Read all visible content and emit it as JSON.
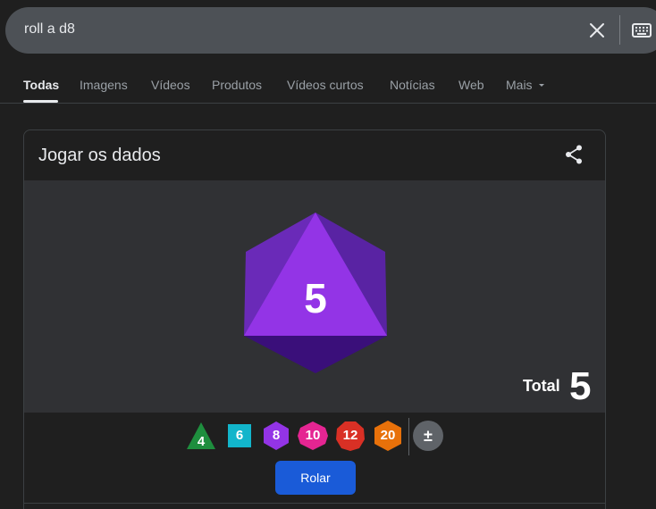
{
  "search": {
    "query": "roll a d8"
  },
  "tabs": [
    {
      "label": "Todas",
      "active": true
    },
    {
      "label": "Imagens"
    },
    {
      "label": "Vídeos"
    },
    {
      "label": "Produtos"
    },
    {
      "label": "Vídeos curtos"
    },
    {
      "label": "Notícias"
    },
    {
      "label": "Web"
    },
    {
      "label": "Mais"
    }
  ],
  "icons": {
    "clear": "close-icon",
    "keyboard": "keyboard-icon",
    "more": "caret-down-icon",
    "share": "share-icon"
  },
  "card": {
    "title": "Jogar os dados",
    "die_face": "5",
    "total_label": "Total",
    "total_value": "5",
    "dice": [
      {
        "label": "4",
        "color": "#1e8e3e",
        "shape": "triangle"
      },
      {
        "label": "6",
        "color": "#12b5cb",
        "shape": "square"
      },
      {
        "label": "8",
        "color": "#9334e6",
        "shape": "hexagon"
      },
      {
        "label": "10",
        "color": "#e52592",
        "shape": "diamond"
      },
      {
        "label": "12",
        "color": "#d93025",
        "shape": "decagon"
      },
      {
        "label": "20",
        "color": "#e8710a",
        "shape": "hexagon"
      },
      {
        "label": "±",
        "color": "#5f6368",
        "shape": "circle"
      }
    ],
    "roll_label": "Rolar"
  },
  "colors": {
    "background": "#1f1f1f",
    "die": "#9334e6",
    "accent_button": "#1a5bd8"
  }
}
